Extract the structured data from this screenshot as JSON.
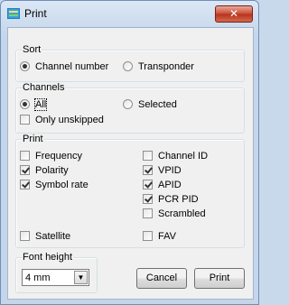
{
  "window": {
    "title": "Print",
    "close_glyph": "✕"
  },
  "sort": {
    "legend": "Sort",
    "channel_number": {
      "label": "Channel number",
      "checked": true
    },
    "transponder": {
      "label": "Transponder",
      "checked": false
    }
  },
  "channels": {
    "legend": "Channels",
    "all": {
      "label": "All",
      "checked": true
    },
    "selected": {
      "label": "Selected",
      "checked": false
    },
    "only_unskipped": {
      "label": "Only unskipped",
      "checked": false
    }
  },
  "print": {
    "legend": "Print",
    "frequency": {
      "label": "Frequency",
      "checked": false
    },
    "polarity": {
      "label": "Polarity",
      "checked": true
    },
    "symbol_rate": {
      "label": "Symbol rate",
      "checked": true
    },
    "satellite": {
      "label": "Satellite",
      "checked": false
    },
    "channel_id": {
      "label": "Channel ID",
      "checked": false
    },
    "vpid": {
      "label": "VPID",
      "checked": true
    },
    "apid": {
      "label": "APID",
      "checked": true
    },
    "pcr_pid": {
      "label": "PCR PID",
      "checked": true
    },
    "scrambled": {
      "label": "Scrambled",
      "checked": false
    },
    "fav": {
      "label": "FAV",
      "checked": false
    }
  },
  "font_height": {
    "legend": "Font height",
    "value": "4 mm",
    "arrow_glyph": "▼"
  },
  "buttons": {
    "cancel": "Cancel",
    "print": "Print"
  }
}
